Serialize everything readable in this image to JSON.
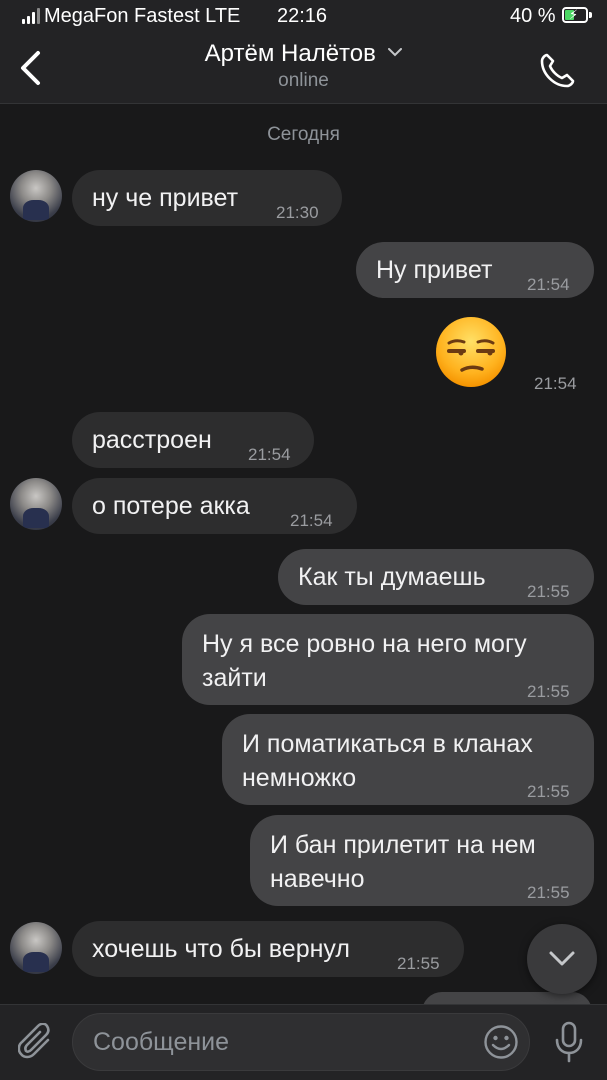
{
  "status_bar": {
    "carrier": "MegaFon Fastest LTE",
    "time": "22:16",
    "battery": "40 %",
    "battery_level": 0.4
  },
  "header": {
    "title": "Артём Налётов",
    "status": "online"
  },
  "chat": {
    "date_separator": "Сегодня",
    "messages": [
      {
        "direction": "in",
        "text": "ну че привет",
        "time": "21:30"
      },
      {
        "direction": "out",
        "text": "Ну привет",
        "time": "21:54"
      },
      {
        "direction": "out",
        "text": "😒",
        "time": "21:54",
        "type": "emoji"
      },
      {
        "direction": "in",
        "text": "расстроен",
        "time": "21:54"
      },
      {
        "direction": "in",
        "text": "о потере акка",
        "time": "21:54"
      },
      {
        "direction": "out",
        "text": "Как ты думаешь",
        "time": "21:55"
      },
      {
        "direction": "out",
        "text": "Ну я все ровно на него могу зайти",
        "time": "21:55"
      },
      {
        "direction": "out",
        "text": "И поматикаться в кланах немножко",
        "time": "21:55"
      },
      {
        "direction": "out",
        "text": "И бан прилетит на нем навечно",
        "time": "21:55"
      },
      {
        "direction": "in",
        "text": "хочешь что бы вернул",
        "time": "21:55"
      }
    ]
  },
  "composer": {
    "placeholder": "Сообщение"
  },
  "colors": {
    "background": "#19191a",
    "bar": "#232325",
    "incoming_bubble": "#2d2d2e",
    "outgoing_bubble": "#444446",
    "muted_text": "#8e9399"
  }
}
